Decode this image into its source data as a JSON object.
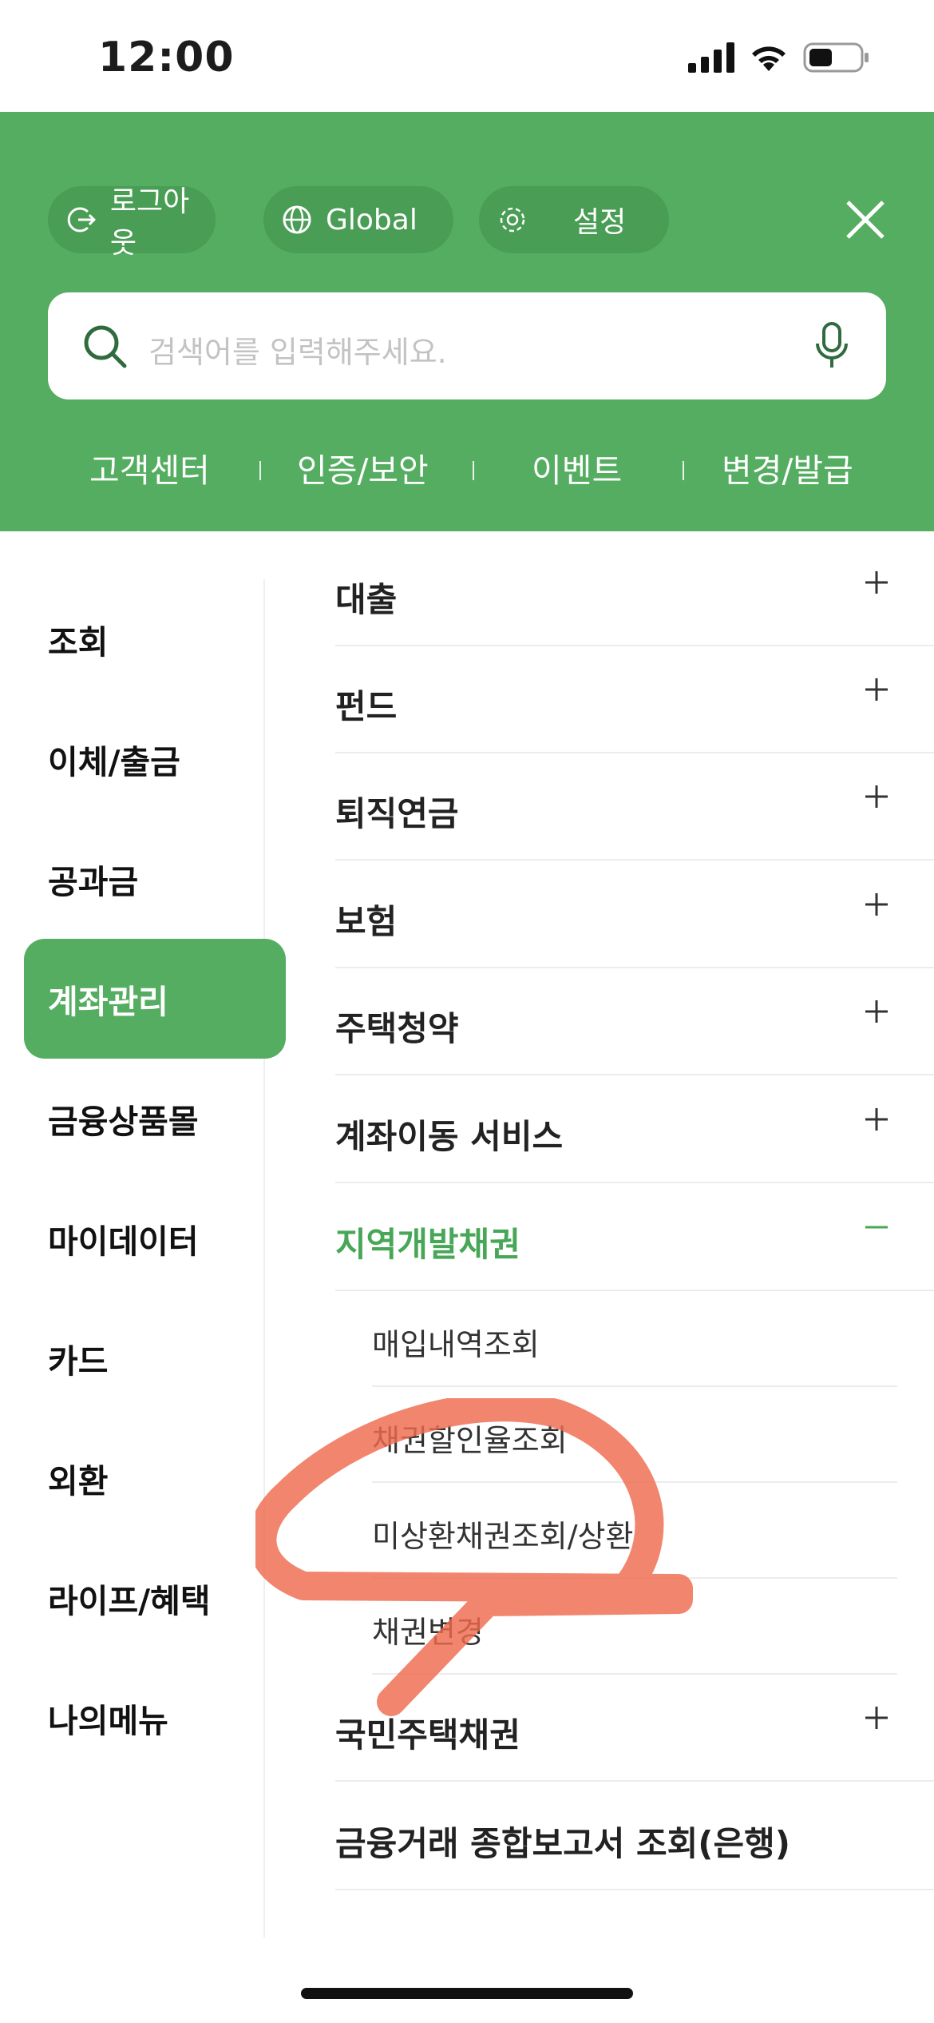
{
  "status": {
    "time": "12:00",
    "icons": [
      "signal-icon",
      "wifi-icon",
      "battery-icon"
    ]
  },
  "header": {
    "logout_label": "로그아웃",
    "global_label": "Global",
    "settings_label": "설정",
    "search_placeholder": "검색어를 입력해주세요.",
    "quick_links": [
      "고객센터",
      "인증/보안",
      "이벤트",
      "변경/발급"
    ],
    "accent": "#55ad61"
  },
  "left_nav": {
    "items": [
      "조회",
      "이체/출금",
      "공과금",
      "계좌관리",
      "금융상품몰",
      "마이데이터",
      "카드",
      "외환",
      "라이프/혜택",
      "나의메뉴"
    ],
    "active_index": 3
  },
  "menu": {
    "items": [
      "대출",
      "펀드",
      "퇴직연금",
      "보험",
      "주택청약",
      "계좌이동 서비스",
      "지역개발채권",
      "국민주택채권",
      "금융거래 종합보고서 조회(은행)"
    ],
    "expanded_item": "지역개발채권",
    "sub_items": [
      "매입내역조회",
      "채권할인율조회",
      "미상환채권조회/상환",
      "채권변경"
    ]
  },
  "annotation_color": "#ef6a4e"
}
